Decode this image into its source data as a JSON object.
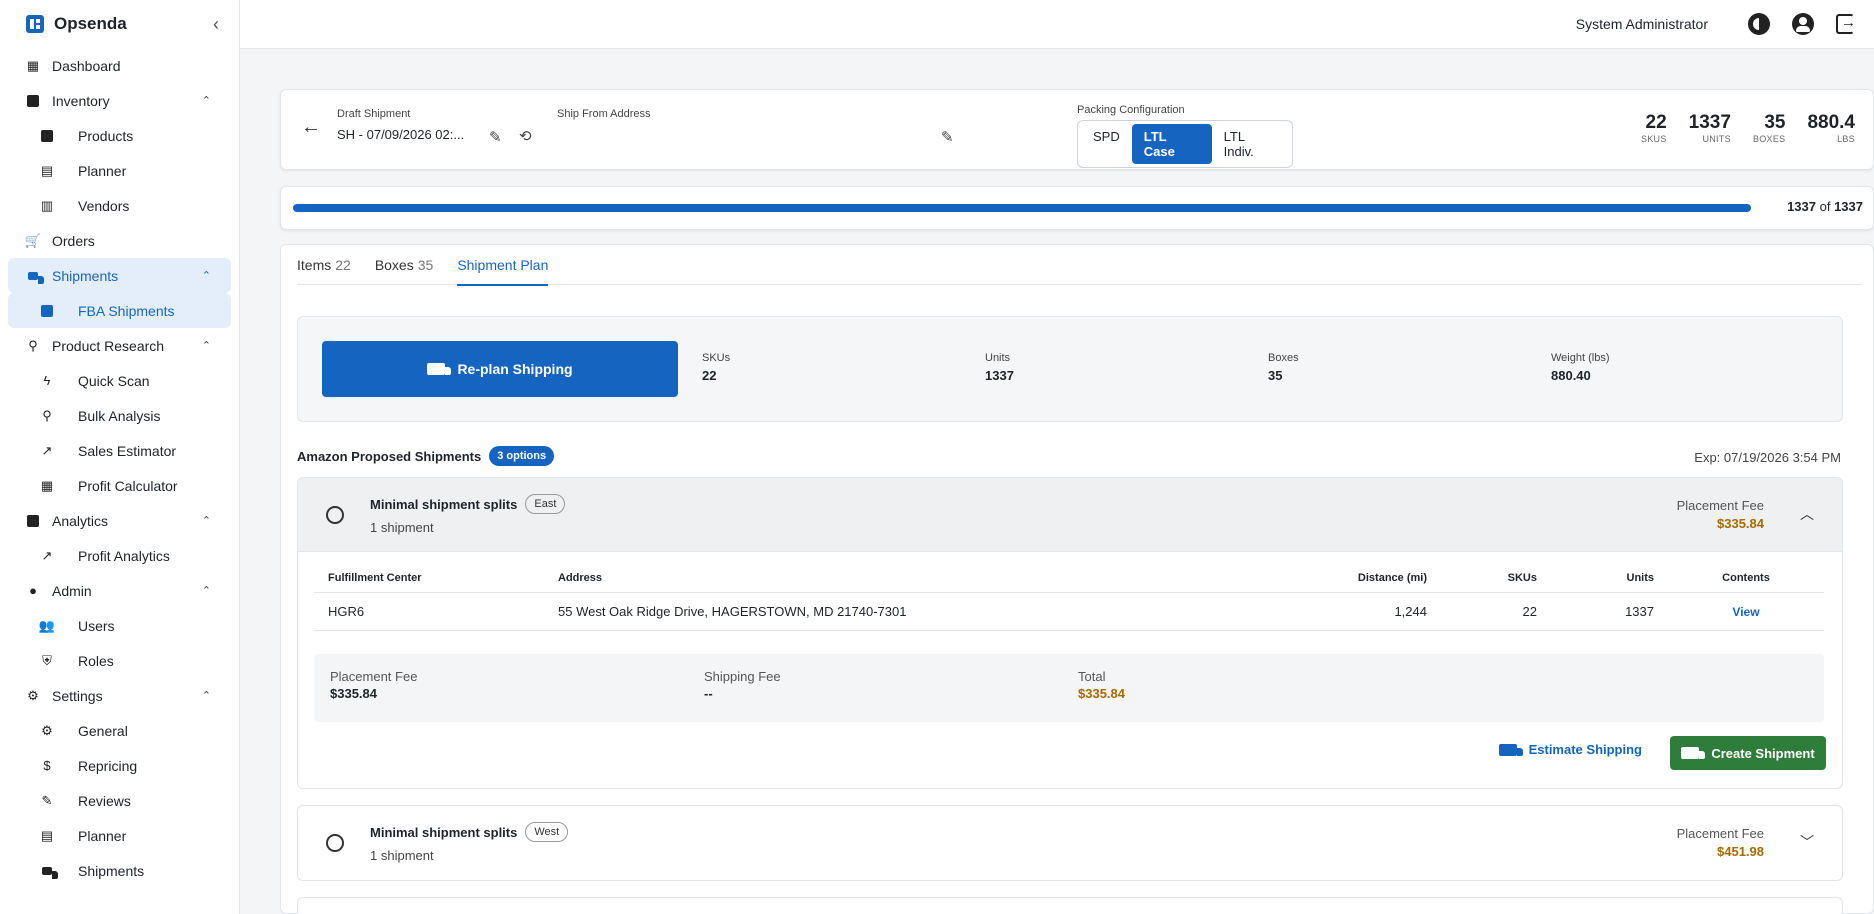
{
  "app": {
    "name": "Opsenda",
    "collapse_icon": "chevron-left-icon"
  },
  "sidebar": {
    "items": [
      {
        "label": "Dashboard",
        "icon": "dashboard-icon"
      },
      {
        "label": "Inventory",
        "icon": "inventory-icon",
        "expanded": true
      },
      {
        "label": "Products",
        "icon": "products-icon"
      },
      {
        "label": "Planner",
        "icon": "planner-icon"
      },
      {
        "label": "Vendors",
        "icon": "vendors-icon"
      },
      {
        "label": "Orders",
        "icon": "cart-icon"
      },
      {
        "label": "Shipments",
        "icon": "truck-icon",
        "expanded": true,
        "active": true
      },
      {
        "label": "FBA Shipments",
        "icon": "box-icon",
        "active": true
      },
      {
        "label": "Product Research",
        "icon": "search-icon",
        "expanded": true
      },
      {
        "label": "Quick Scan",
        "icon": "bolt-icon"
      },
      {
        "label": "Bulk Analysis",
        "icon": "search-icon"
      },
      {
        "label": "Sales Estimator",
        "icon": "trending-icon"
      },
      {
        "label": "Profit Calculator",
        "icon": "calculator-icon"
      },
      {
        "label": "Analytics",
        "icon": "analytics-icon",
        "expanded": true
      },
      {
        "label": "Profit Analytics",
        "icon": "trending-icon"
      },
      {
        "label": "Admin",
        "icon": "admin-icon",
        "expanded": true
      },
      {
        "label": "Users",
        "icon": "users-icon"
      },
      {
        "label": "Roles",
        "icon": "shield-icon"
      },
      {
        "label": "Settings",
        "icon": "gear-icon",
        "expanded": true
      },
      {
        "label": "General",
        "icon": "gear-icon"
      },
      {
        "label": "Repricing",
        "icon": "dollar-icon"
      },
      {
        "label": "Reviews",
        "icon": "review-icon"
      },
      {
        "label": "Planner",
        "icon": "planner-icon"
      },
      {
        "label": "Shipments",
        "icon": "truck-icon"
      }
    ]
  },
  "topbar": {
    "user": "System Administrator",
    "icons": [
      "theme-toggle-icon",
      "account-icon",
      "logout-icon"
    ]
  },
  "header": {
    "draft_label": "Draft Shipment",
    "draft_value": "SH - 07/09/2026 02:...",
    "ship_from_label": "Ship From Address",
    "packing_label": "Packing Configuration",
    "packing_options": [
      "SPD",
      "LTL Case",
      "LTL Indiv."
    ],
    "packing_selected": "LTL Case",
    "stats": [
      {
        "value": "22",
        "unit": "SKUS"
      },
      {
        "value": "1337",
        "unit": "UNITS"
      },
      {
        "value": "35",
        "unit": "BOXES"
      },
      {
        "value": "880.4",
        "unit": "LBS"
      }
    ]
  },
  "progress": {
    "done": "1337",
    "of": "of",
    "total": "1337",
    "fraction": 1.0
  },
  "tabs": [
    {
      "label": "Items",
      "count": "22"
    },
    {
      "label": "Boxes",
      "count": "35"
    },
    {
      "label": "Shipment Plan",
      "count": ""
    }
  ],
  "summary": {
    "replan_label": "Re-plan Shipping",
    "skus_label": "SKUs",
    "skus": "22",
    "units_label": "Units",
    "units": "1337",
    "boxes_label": "Boxes",
    "boxes": "35",
    "weight_label": "Weight (lbs)",
    "weight": "880.40"
  },
  "proposed": {
    "title": "Amazon Proposed Shipments",
    "badge": "3 options",
    "expires": "Exp: 07/19/2026 3:54 PM"
  },
  "options": [
    {
      "title": "Minimal shipment splits",
      "region": "East",
      "subtitle": "1 shipment",
      "fee_label": "Placement Fee",
      "fee": "$335.84",
      "table": {
        "headers": [
          "Fulfillment Center",
          "Address",
          "Distance (mi)",
          "SKUs",
          "Units",
          "Contents"
        ],
        "rows": [
          {
            "fc": "HGR6",
            "address": "55 West Oak Ridge Drive, HAGERSTOWN, MD 21740-7301",
            "distance": "1,244",
            "skus": "22",
            "units": "1337",
            "contents": "View"
          }
        ]
      },
      "fees": {
        "placement_label": "Placement Fee",
        "placement": "$335.84",
        "shipping_label": "Shipping Fee",
        "shipping": "--",
        "total_label": "Total",
        "total": "$335.84"
      },
      "estimate_label": "Estimate Shipping",
      "create_label": "Create Shipment"
    },
    {
      "title": "Minimal shipment splits",
      "region": "West",
      "subtitle": "1 shipment",
      "fee_label": "Placement Fee",
      "fee": "$451.98"
    }
  ]
}
